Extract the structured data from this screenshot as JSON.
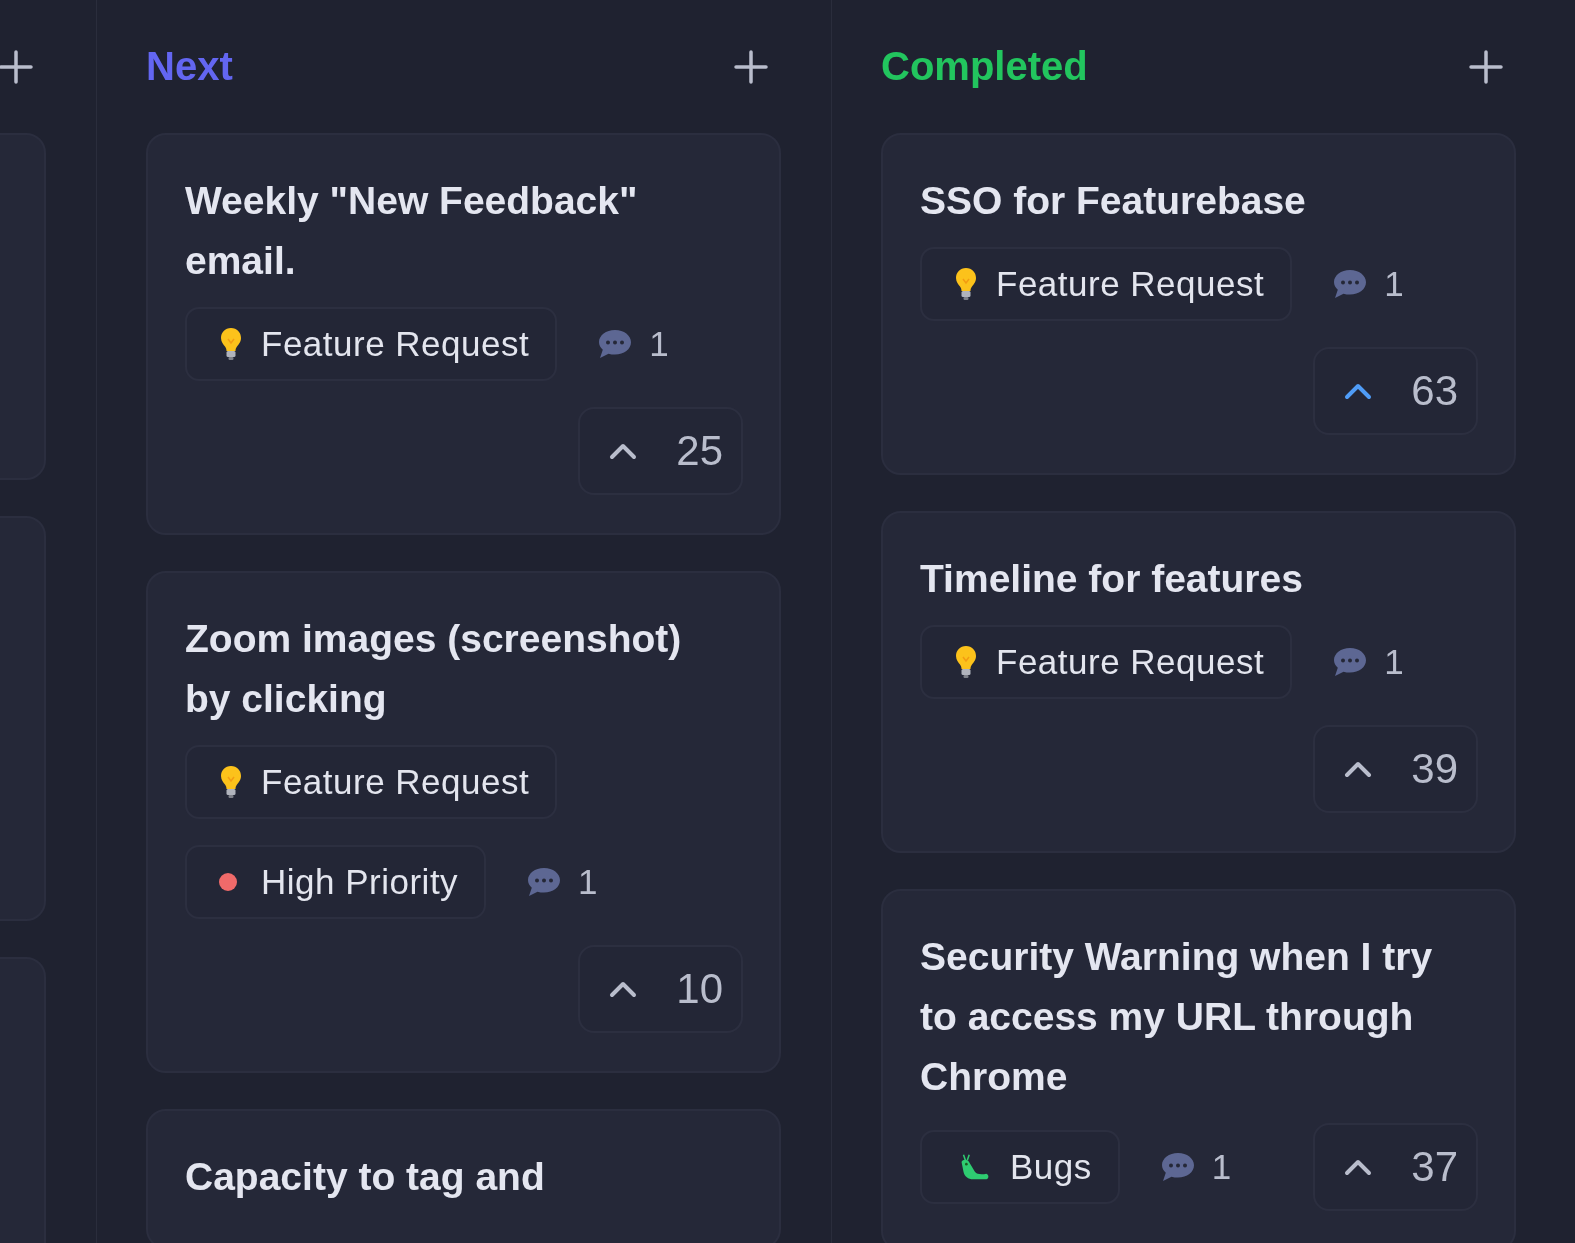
{
  "columns": [
    {
      "title": "Next",
      "color": "#6366f1",
      "cards": [
        {
          "title": "Weekly \"New Feedback\" email.",
          "tags": [
            {
              "kind": "feature",
              "label": "Feature Request"
            }
          ],
          "comments": "1",
          "votes": "25",
          "upvoted": false
        },
        {
          "title": "Zoom images (screenshot) by clicking",
          "tags": [
            {
              "kind": "feature",
              "label": "Feature Request"
            },
            {
              "kind": "priority",
              "label": "High Priority",
              "color": "#f06a6a"
            }
          ],
          "comments": "1",
          "votes": "10",
          "upvoted": false
        },
        {
          "title": "Capacity to tag and",
          "cut": true
        }
      ]
    },
    {
      "title": "Completed",
      "color": "#22c55e",
      "cards": [
        {
          "title": "SSO for Featurebase",
          "tags": [
            {
              "kind": "feature",
              "label": "Feature Request"
            }
          ],
          "comments": "1",
          "votes": "63",
          "upvoted": true
        },
        {
          "title": "Timeline for features",
          "tags": [
            {
              "kind": "feature",
              "label": "Feature Request"
            }
          ],
          "comments": "1",
          "votes": "39",
          "upvoted": false
        },
        {
          "title": "Security Warning when I try to access my URL through Chrome",
          "tags": [
            {
              "kind": "bug",
              "label": "Bugs"
            }
          ],
          "comments": "1",
          "votes": "37",
          "upvoted": false
        }
      ]
    }
  ]
}
